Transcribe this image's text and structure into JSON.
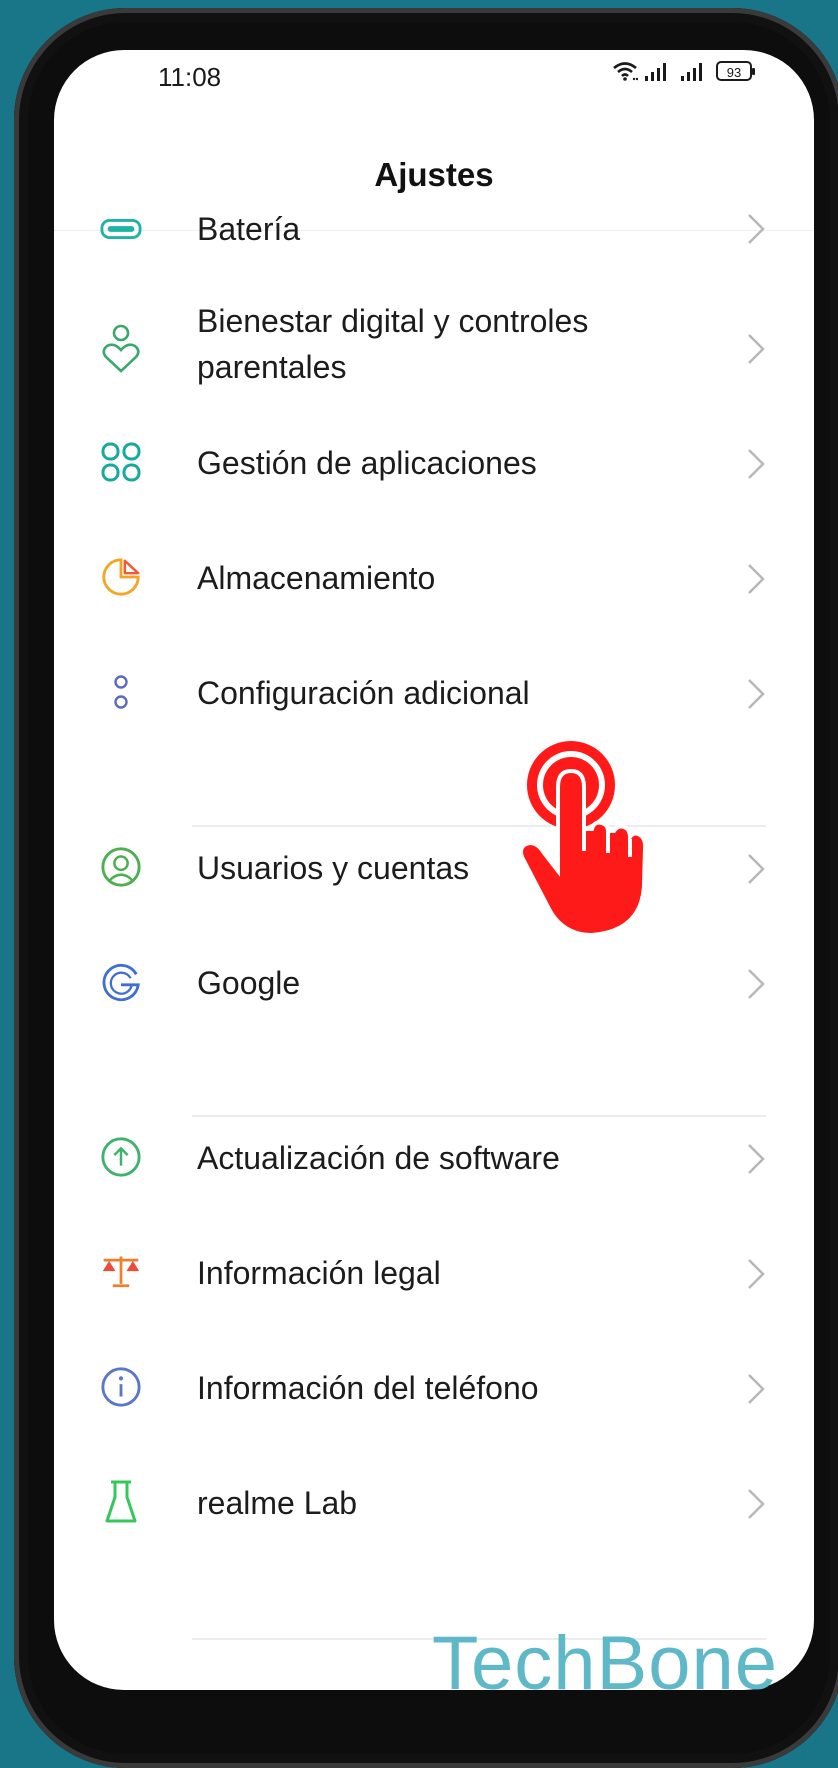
{
  "status_bar": {
    "time": "11:08",
    "battery_level": "93",
    "icons": [
      "wifi-icon",
      "signal-icon",
      "signal-icon",
      "battery-icon"
    ]
  },
  "header": {
    "title": "Ajustes"
  },
  "settings": {
    "items": [
      {
        "label": "Batería",
        "icon": "battery-icon",
        "color": "#1fb3a6"
      },
      {
        "label_line1": "Bienestar digital y controles",
        "label_line2": "parentales",
        "icon": "digital-wellbeing-icon",
        "color": "#3aa86b"
      },
      {
        "label": "Gestión de aplicaciones",
        "icon": "apps-grid-icon",
        "color": "#17a9a0"
      },
      {
        "label": "Almacenamiento",
        "icon": "storage-pie-icon",
        "color": "#f4a623"
      },
      {
        "label": "Configuración adicional",
        "icon": "more-dots-icon",
        "color": "#5c6bc0"
      },
      {
        "label": "Usuarios y cuentas",
        "icon": "user-icon",
        "color": "#4caf50"
      },
      {
        "label": "Google",
        "icon": "google-g-icon",
        "color": "#3f6fd1"
      },
      {
        "label": "Actualización de software",
        "icon": "update-arrow-icon",
        "color": "#3fb36b"
      },
      {
        "label": "Información legal",
        "icon": "scales-icon",
        "color": "#f07f2b"
      },
      {
        "label": "Información del teléfono",
        "icon": "info-icon",
        "color": "#5b78c6"
      },
      {
        "label": "realme Lab",
        "icon": "flask-icon",
        "color": "#34c759"
      }
    ]
  },
  "overlay": {
    "tap_indicator_color": "#ff1a1a"
  },
  "watermark": "TechBone"
}
